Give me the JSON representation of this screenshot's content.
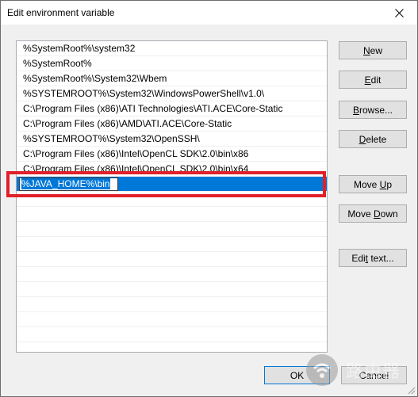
{
  "window": {
    "title": "Edit environment variable"
  },
  "list": {
    "items": [
      "%SystemRoot%\\system32",
      "%SystemRoot%",
      "%SystemRoot%\\System32\\Wbem",
      "%SYSTEMROOT%\\System32\\WindowsPowerShell\\v1.0\\",
      "C:\\Program Files (x86)\\ATI Technologies\\ATI.ACE\\Core-Static",
      "C:\\Program Files (x86)\\AMD\\ATI.ACE\\Core-Static",
      "%SYSTEMROOT%\\System32\\OpenSSH\\",
      "C:\\Program Files (x86)\\Intel\\OpenCL SDK\\2.0\\bin\\x86",
      "C:\\Program Files (x86)\\Intel\\OpenCL SDK\\2.0\\bin\\x64"
    ],
    "editing_value": "%JAVA_HOME%\\bin"
  },
  "buttons": {
    "new": {
      "accel": "N",
      "rest": "ew"
    },
    "edit": {
      "accel": "E",
      "rest": "dit"
    },
    "browse": {
      "accel": "B",
      "rest": "rowse..."
    },
    "delete": {
      "accel": "D",
      "rest": "elete"
    },
    "move_up": {
      "pre": "Move ",
      "accel": "U",
      "rest": "p"
    },
    "move_down": {
      "pre": "Move ",
      "accel": "D",
      "rest": "own"
    },
    "edit_text": {
      "pre": "Edi",
      "accel": "t",
      "rest": " text..."
    },
    "ok": "OK",
    "cancel": "Cancel"
  },
  "watermark": {
    "text": "路由器"
  },
  "colors": {
    "selection": "#0078d7",
    "highlight_box": "#e0202a"
  }
}
